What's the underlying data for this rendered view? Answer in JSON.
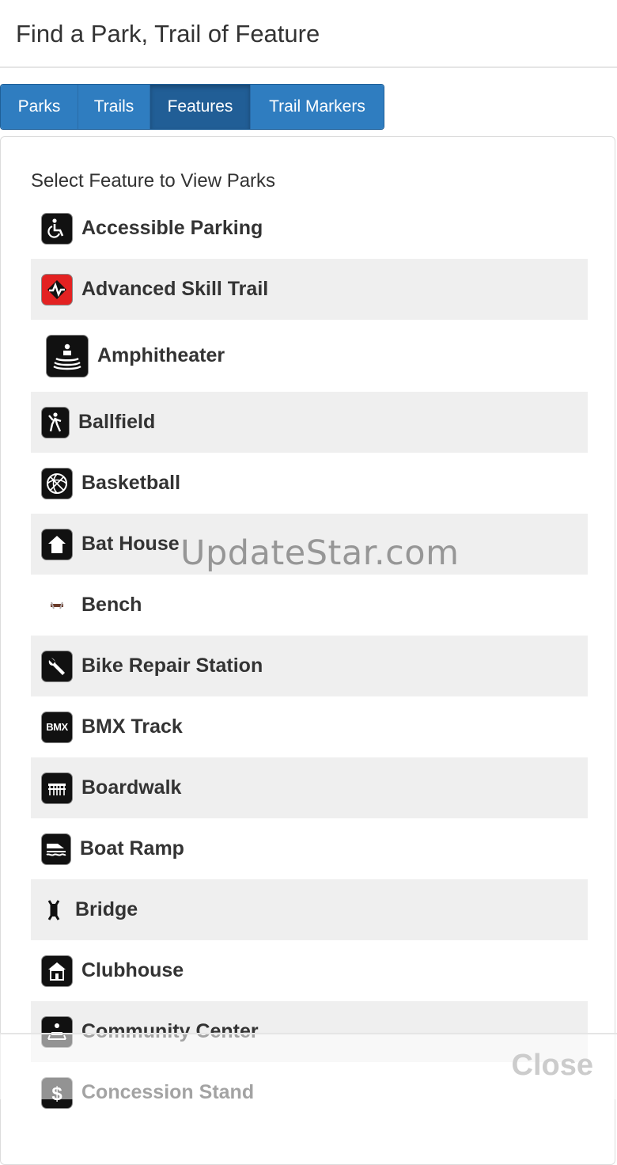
{
  "header": {
    "title": "Find a Park, Trail of Feature"
  },
  "tabs": [
    {
      "label": "Parks"
    },
    {
      "label": "Trails"
    },
    {
      "label": "Features"
    },
    {
      "label": "Trail Markers"
    }
  ],
  "panel": {
    "title": "Select Feature to View Parks"
  },
  "features": [
    {
      "label": "Accessible Parking",
      "icon": "wheelchair-icon"
    },
    {
      "label": "Advanced Skill Trail",
      "icon": "skill-trail-icon"
    },
    {
      "label": "Amphitheater",
      "icon": "amphitheater-icon"
    },
    {
      "label": "Ballfield",
      "icon": "ballfield-icon"
    },
    {
      "label": "Basketball",
      "icon": "basketball-icon"
    },
    {
      "label": "Bat House",
      "icon": "bat-house-icon"
    },
    {
      "label": "Bench",
      "icon": "bench-icon"
    },
    {
      "label": "Bike Repair Station",
      "icon": "wrench-icon"
    },
    {
      "label": "BMX Track",
      "icon": "bmx-icon",
      "icon_text": "BMX"
    },
    {
      "label": "Boardwalk",
      "icon": "boardwalk-icon"
    },
    {
      "label": "Boat Ramp",
      "icon": "boat-ramp-icon"
    },
    {
      "label": "Bridge",
      "icon": "bridge-icon"
    },
    {
      "label": "Clubhouse",
      "icon": "clubhouse-icon"
    },
    {
      "label": "Community Center",
      "icon": "community-center-icon"
    },
    {
      "label": "Concession Stand",
      "icon": "dollar-icon"
    }
  ],
  "watermark": "UpdateStar.com",
  "footer": {
    "close_label": "Close"
  }
}
